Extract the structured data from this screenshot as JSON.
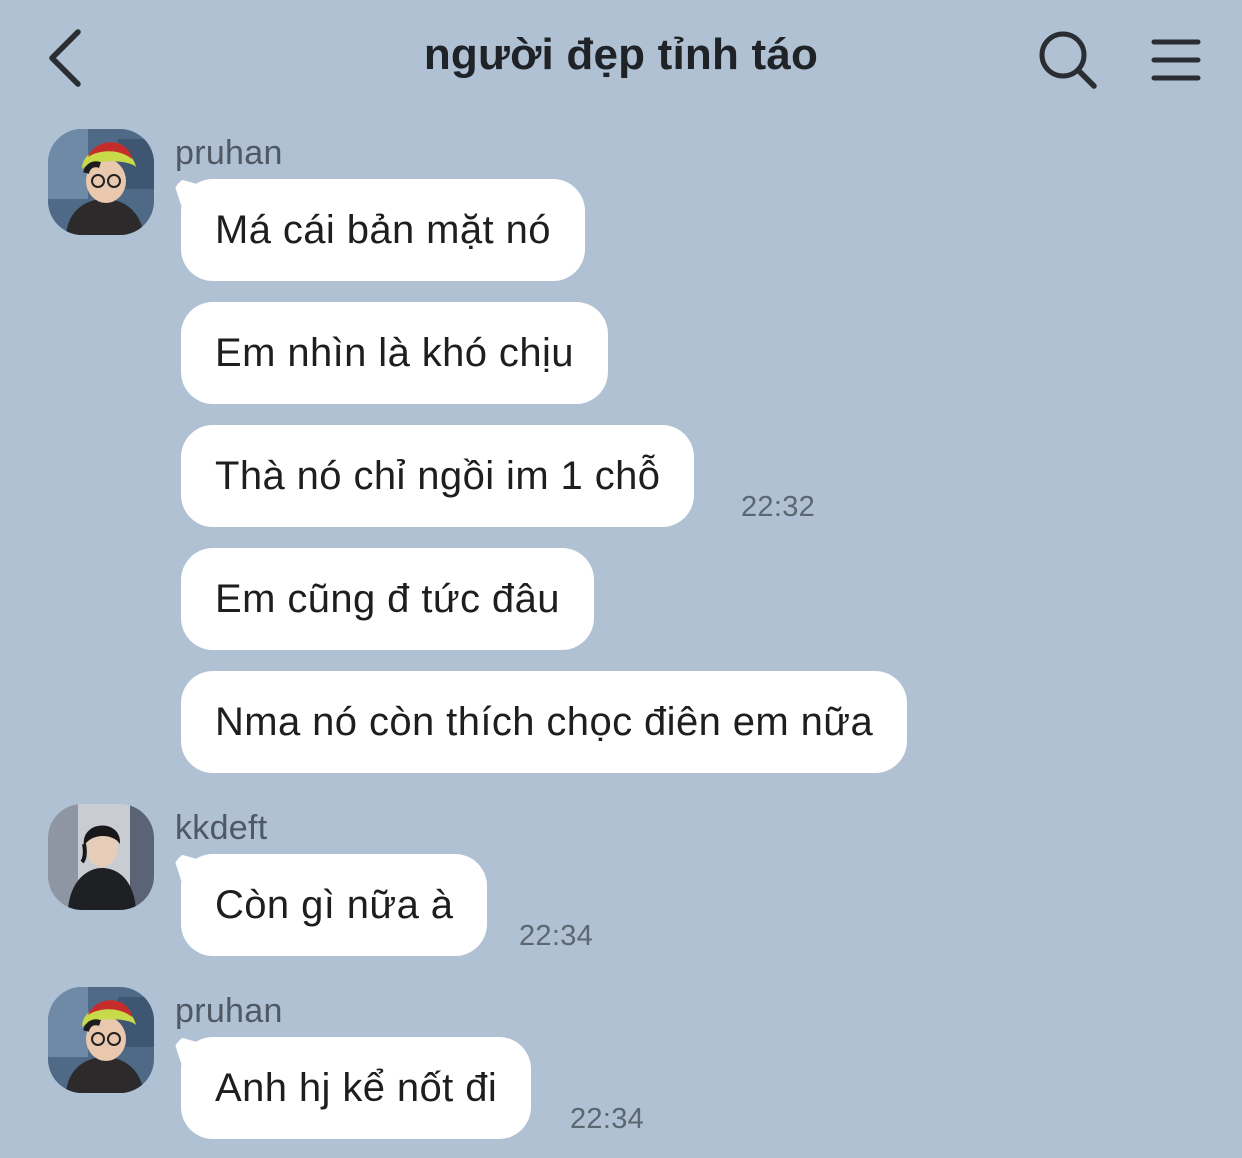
{
  "header": {
    "title": "người đẹp tỉnh táo",
    "back_icon": "chevron-left-icon",
    "search_icon": "search-icon",
    "menu_icon": "hamburger-menu-icon"
  },
  "groups": [
    {
      "sender": "pruhan",
      "avatar": "avatar-pruhan",
      "messages": [
        {
          "text": "Má cái bản mặt nó"
        },
        {
          "text": "Em nhìn là khó chịu"
        },
        {
          "text": "Thà nó chỉ ngồi im 1 chỗ",
          "time": "22:32"
        },
        {
          "text": "Em cũng đ tức đâu"
        },
        {
          "text": "Nma nó còn thích chọc điên em nữa"
        }
      ]
    },
    {
      "sender": "kkdeft",
      "avatar": "avatar-kkdeft",
      "messages": [
        {
          "text": "Còn gì nữa à",
          "time": "22:34"
        }
      ]
    },
    {
      "sender": "pruhan",
      "avatar": "avatar-pruhan",
      "messages": [
        {
          "text": "Anh hj kể nốt đi",
          "time": "22:34"
        }
      ]
    }
  ]
}
